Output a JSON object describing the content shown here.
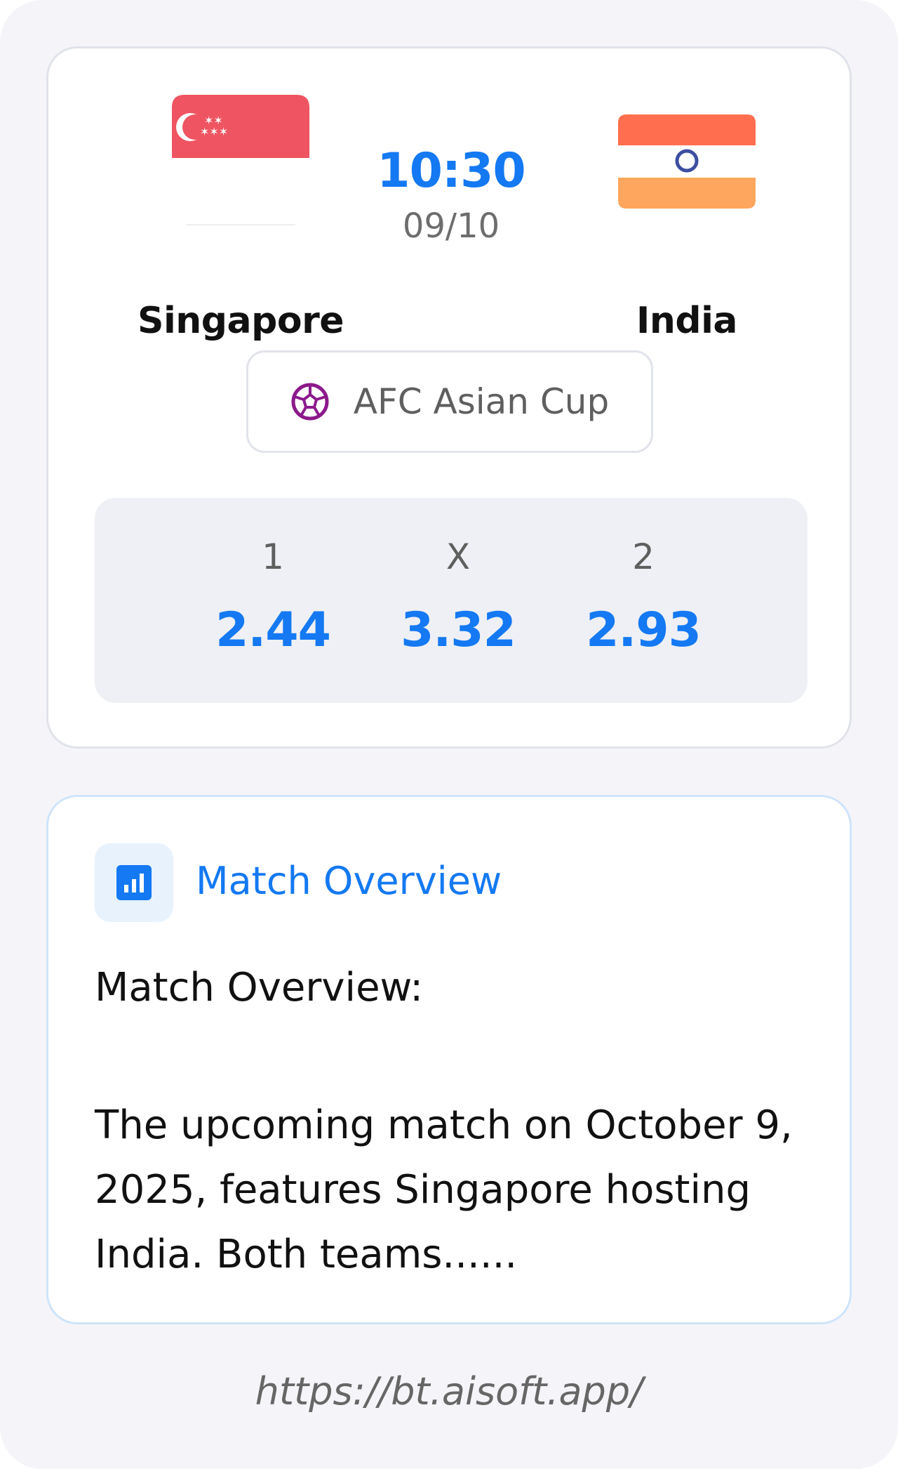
{
  "match": {
    "home_team": {
      "name": "Singapore",
      "flag": "singapore-flag"
    },
    "away_team": {
      "name": "India",
      "flag": "india-flag"
    },
    "kickoff_time": "10:30",
    "kickoff_date": "09/10",
    "competition": {
      "label": "AFC Asian Cup",
      "icon": "football-icon"
    },
    "odds": [
      {
        "label": "1",
        "value": "2.44"
      },
      {
        "label": "X",
        "value": "3.32"
      },
      {
        "label": "2",
        "value": "2.93"
      }
    ]
  },
  "overview": {
    "icon": "bar-chart-icon",
    "title": "Match Overview",
    "heading": "Match Overview:",
    "body": "The upcoming match on October 9, 2025, features Singapore hosting India. Both teams......"
  },
  "footer": {
    "url": "https://bt.aisoft.app/"
  },
  "colors": {
    "accent": "#1479f2",
    "page_background": "#f5f5f9",
    "odds_background": "#eef0f5",
    "singapore_red": "#ee5461",
    "india_saffron": "#ff6f4f",
    "india_green": "#ffa65e",
    "football_purple": "#8b1a8b"
  }
}
